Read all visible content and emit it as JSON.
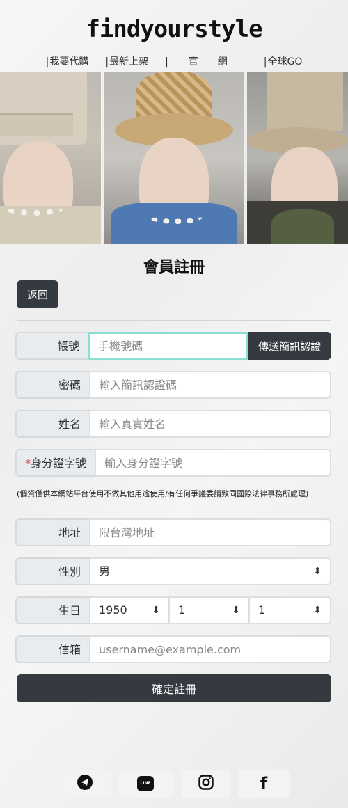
{
  "brand": {
    "logo": "findyourstyle"
  },
  "nav": {
    "items": [
      "我要代購",
      "最新上架",
      "官網",
      "全球GO"
    ]
  },
  "page": {
    "title": "會員註冊"
  },
  "back_button": "返回",
  "form": {
    "account": {
      "label": "帳號",
      "placeholder": "手機號碼",
      "send_code": "傳送簡訊認證"
    },
    "password": {
      "label": "密碼",
      "placeholder": "輸入簡訊認證碼"
    },
    "name": {
      "label": "姓名",
      "placeholder": "輸入真實姓名"
    },
    "id_number": {
      "required_mark": "*",
      "label": "身分證字號",
      "placeholder": "輸入身分證字號"
    },
    "privacy_note": "(個資僅供本網站平台使用不做其他用途使用/有任何爭議委請致同國際法律事務所處理)",
    "address": {
      "label": "地址",
      "placeholder": "限台灣地址"
    },
    "gender": {
      "label": "性別",
      "value": "男"
    },
    "birthday": {
      "label": "生日",
      "year": "1950",
      "month": "1",
      "day": "1"
    },
    "email": {
      "label": "信箱",
      "placeholder": "username@example.com"
    },
    "submit": "確定註冊"
  },
  "social": {
    "icons": [
      "telegram-icon",
      "line-icon",
      "instagram-icon",
      "facebook-icon"
    ],
    "line_text": "LINE",
    "facebook_glyph": "f"
  }
}
